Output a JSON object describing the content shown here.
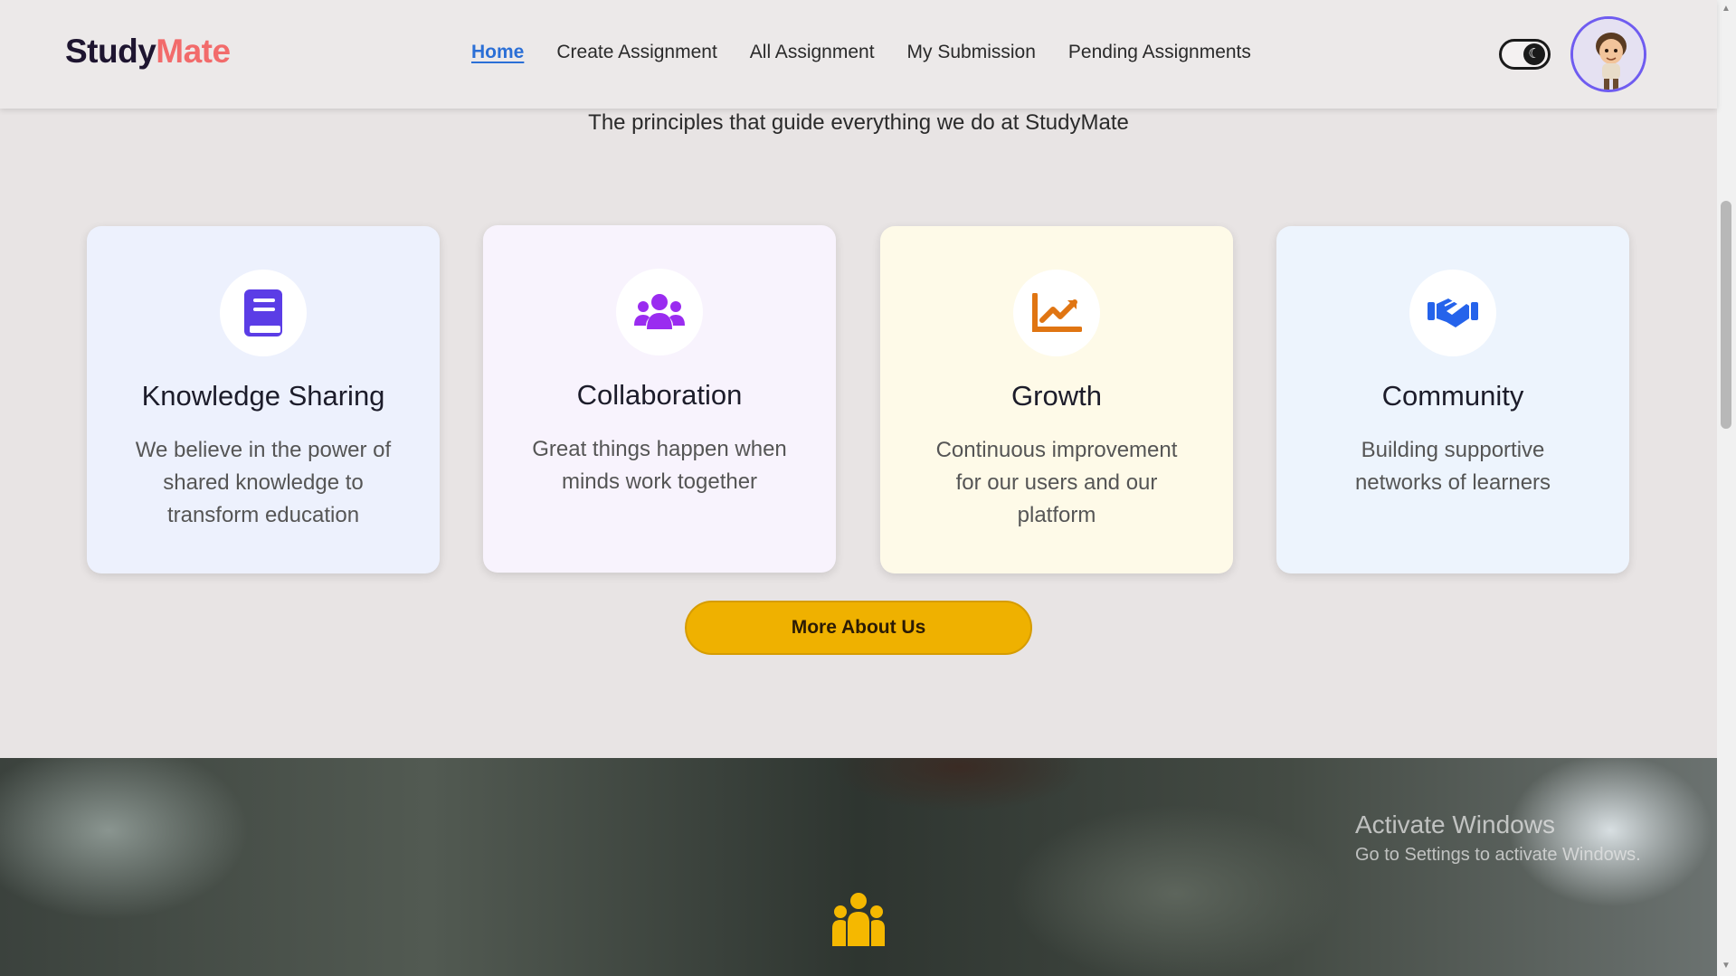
{
  "brand": {
    "part1": "Study",
    "part2": "Mate"
  },
  "nav": {
    "items": [
      {
        "label": "Home",
        "active": true
      },
      {
        "label": "Create Assignment"
      },
      {
        "label": "All Assignment"
      },
      {
        "label": "My Submission"
      },
      {
        "label": "Pending Assignments"
      }
    ]
  },
  "header": {
    "theme_toggle_icon": "moon-icon",
    "avatar_icon": "user-avatar"
  },
  "values_section": {
    "subtitle": "The principles that guide everything we do at StudyMate",
    "cards": [
      {
        "title": "Knowledge Sharing",
        "text": "We believe in the power of shared knowledge to transform education",
        "icon": "book-icon",
        "color": "#5b3de6"
      },
      {
        "title": "Collaboration",
        "text": "Great things happen when minds work together",
        "icon": "users-icon",
        "color": "#9a2cf0"
      },
      {
        "title": "Growth",
        "text": "Continuous improvement for our users and our platform",
        "icon": "chart-line-icon",
        "color": "#e07512"
      },
      {
        "title": "Community",
        "text": "Building supportive networks of learners",
        "icon": "handshake-icon",
        "color": "#2563eb"
      }
    ],
    "more_button": "More About Us"
  },
  "hero": {
    "icon": "group-icon",
    "icon_color": "#f5b800"
  },
  "watermark": {
    "title": "Activate Windows",
    "subtitle": "Go to Settings to activate Windows."
  }
}
